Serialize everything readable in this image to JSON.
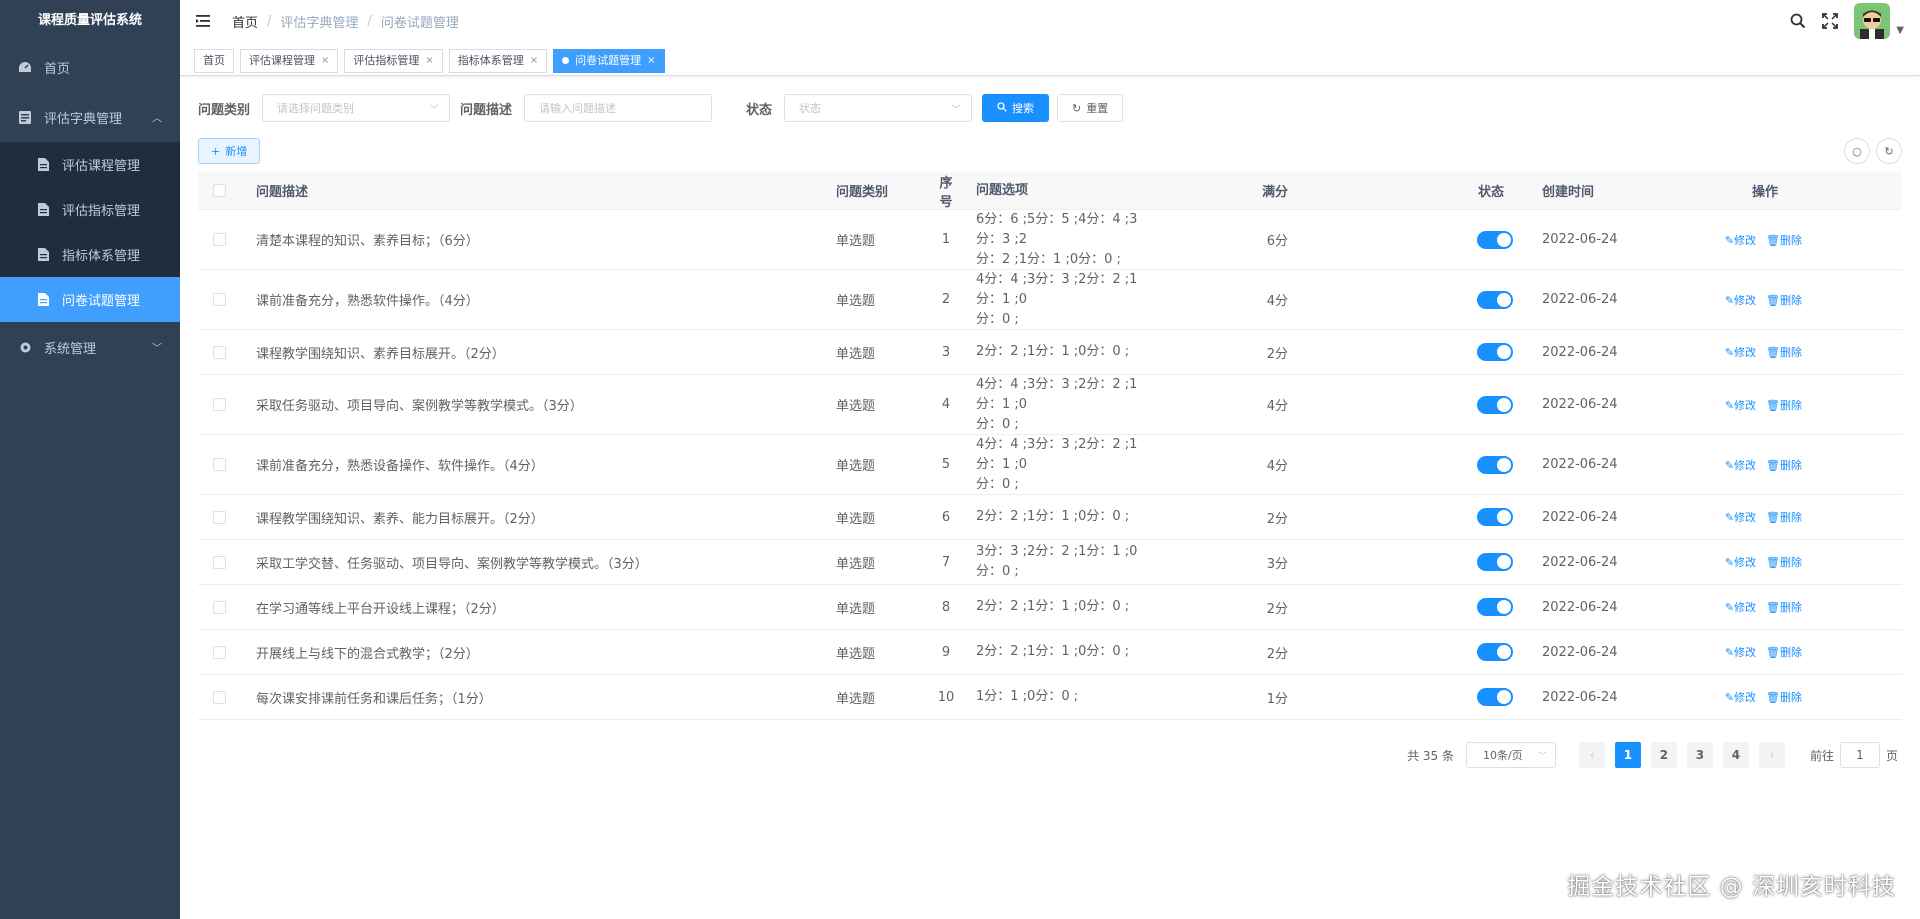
{
  "app_title": "课程质量评估系统",
  "sidebar": {
    "home": "首页",
    "dict": "评估字典管理",
    "sub_items": [
      "评估课程管理",
      "评估指标管理",
      "指标体系管理",
      "问卷试题管理"
    ],
    "system": "系统管理"
  },
  "breadcrumb": [
    "首页",
    "评估字典管理",
    "问卷试题管理"
  ],
  "tags": [
    "首页",
    "评估课程管理",
    "评估指标管理",
    "指标体系管理",
    "问卷试题管理"
  ],
  "search": {
    "category_label": "问题类别",
    "category_placeholder": "请选择问题类别",
    "desc_label": "问题描述",
    "desc_placeholder": "请输入问题描述",
    "status_label": "状态",
    "status_placeholder": "状态",
    "search_button": "搜索",
    "reset_button": "重置"
  },
  "toolbar": {
    "add_button": "新增"
  },
  "table": {
    "headers": [
      "问题描述",
      "问题类别",
      "序号",
      "问题选项",
      "满分",
      "状态",
      "创建时间",
      "操作"
    ],
    "edit_label": "修改",
    "delete_label": "删除",
    "rows": [
      {
        "desc": "清楚本课程的知识、素养目标；（6分）",
        "type": "单选题",
        "no": "1",
        "opts1": "6分：6 ;5分：5 ;4分：4 ;3分：3 ;2",
        "opts2": "分：2 ;1分：1 ;0分：0 ;",
        "full": "6分",
        "date": "2022-06-24",
        "status_on": true
      },
      {
        "desc": "课前准备充分，熟悉软件操作。（4分）",
        "type": "单选题",
        "no": "2",
        "opts1": "4分：4 ;3分：3 ;2分：2 ;1分：1 ;0",
        "opts2": "分：0 ;",
        "full": "4分",
        "date": "2022-06-24",
        "status_on": true
      },
      {
        "desc": "课程教学围绕知识、素养目标展开。（2分）",
        "type": "单选题",
        "no": "3",
        "opts1": "2分：2 ;1分：1 ;0分：0 ;",
        "opts2": "",
        "full": "2分",
        "date": "2022-06-24",
        "status_on": true
      },
      {
        "desc": "采取任务驱动、项目导向、案例教学等教学模式。（3分）",
        "type": "单选题",
        "no": "4",
        "opts1": "4分：4 ;3分：3 ;2分：2 ;1分：1 ;0",
        "opts2": "分：0 ;",
        "full": "4分",
        "date": "2022-06-24",
        "status_on": true
      },
      {
        "desc": "课前准备充分，熟悉设备操作、软件操作。（4分）",
        "type": "单选题",
        "no": "5",
        "opts1": "4分：4 ;3分：3 ;2分：2 ;1分：1 ;0",
        "opts2": "分：0 ;",
        "full": "4分",
        "date": "2022-06-24",
        "status_on": true
      },
      {
        "desc": "课程教学围绕知识、素养、能力目标展开。（2分）",
        "type": "单选题",
        "no": "6",
        "opts1": "2分：2 ;1分：1 ;0分：0 ;",
        "opts2": "",
        "full": "2分",
        "date": "2022-06-24",
        "status_on": true
      },
      {
        "desc": "采取工学交替、任务驱动、项目导向、案例教学等教学模式。（3分）",
        "type": "单选题",
        "no": "7",
        "opts1": "3分：3 ;2分：2 ;1分：1 ;0分：0 ;",
        "opts2": "",
        "full": "3分",
        "date": "2022-06-24",
        "status_on": true
      },
      {
        "desc": "在学习通等线上平台开设线上课程；（2分）",
        "type": "单选题",
        "no": "8",
        "opts1": "2分：2 ;1分：1 ;0分：0 ;",
        "opts2": "",
        "full": "2分",
        "date": "2022-06-24",
        "status_on": true
      },
      {
        "desc": "开展线上与线下的混合式教学；（2分）",
        "type": "单选题",
        "no": "9",
        "opts1": "2分：2 ;1分：1 ;0分：0 ;",
        "opts2": "",
        "full": "2分",
        "date": "2022-06-24",
        "status_on": true
      },
      {
        "desc": "每次课安排课前任务和课后任务；（1分）",
        "type": "单选题",
        "no": "10",
        "opts1": "1分：1 ;0分：0 ;",
        "opts2": "",
        "full": "1分",
        "date": "2022-06-24",
        "status_on": true
      }
    ]
  },
  "pagination": {
    "total": "共 35 条",
    "page_size": "10条/页",
    "pages": [
      "1",
      "2",
      "3",
      "4"
    ],
    "goto_label": "前往",
    "goto_value": "1",
    "page_suffix": "页"
  },
  "watermark": "掘金技术社区 @ 深圳亥时科技",
  "colors": {
    "sidebar_bg": "#304156",
    "submenu_bg": "#1f2d3d",
    "primary": "#1890ff"
  }
}
